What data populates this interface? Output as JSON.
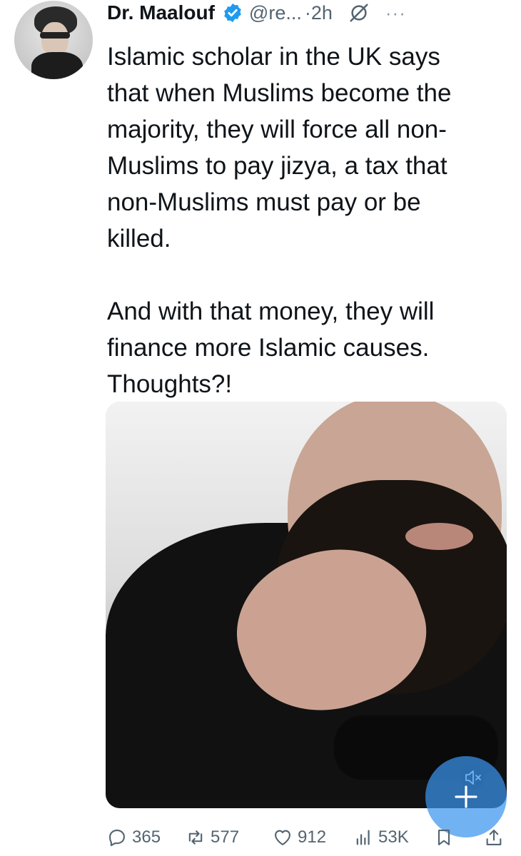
{
  "tweet": {
    "author_name": "Dr. Maalouf",
    "handle": "@re...",
    "time": "·2h",
    "more_label": "···",
    "text": "Islamic scholar in the UK says\nthat when Muslims become the\nmajority, they will force all non-\nMuslims to pay jizya, a tax that\nnon-Muslims must pay or be\nkilled.\n\nAnd with that money, they will\nfinance more Islamic causes.\nThoughts?!"
  },
  "actions": {
    "replies": "365",
    "reposts": "577",
    "likes": "912",
    "views": "53K"
  },
  "icons": {
    "verified": "verified-badge-icon",
    "grok": "grok-icon",
    "more": "more-icon",
    "reply": "reply-icon",
    "repost": "repost-icon",
    "like": "heart-icon",
    "views": "views-icon",
    "bookmark": "bookmark-icon",
    "share": "share-icon",
    "mute": "mute-icon",
    "compose": "plus-icon"
  },
  "colors": {
    "verified": "#1d9bf0",
    "secondary_text": "#536471",
    "fab": "#3a94ee"
  }
}
